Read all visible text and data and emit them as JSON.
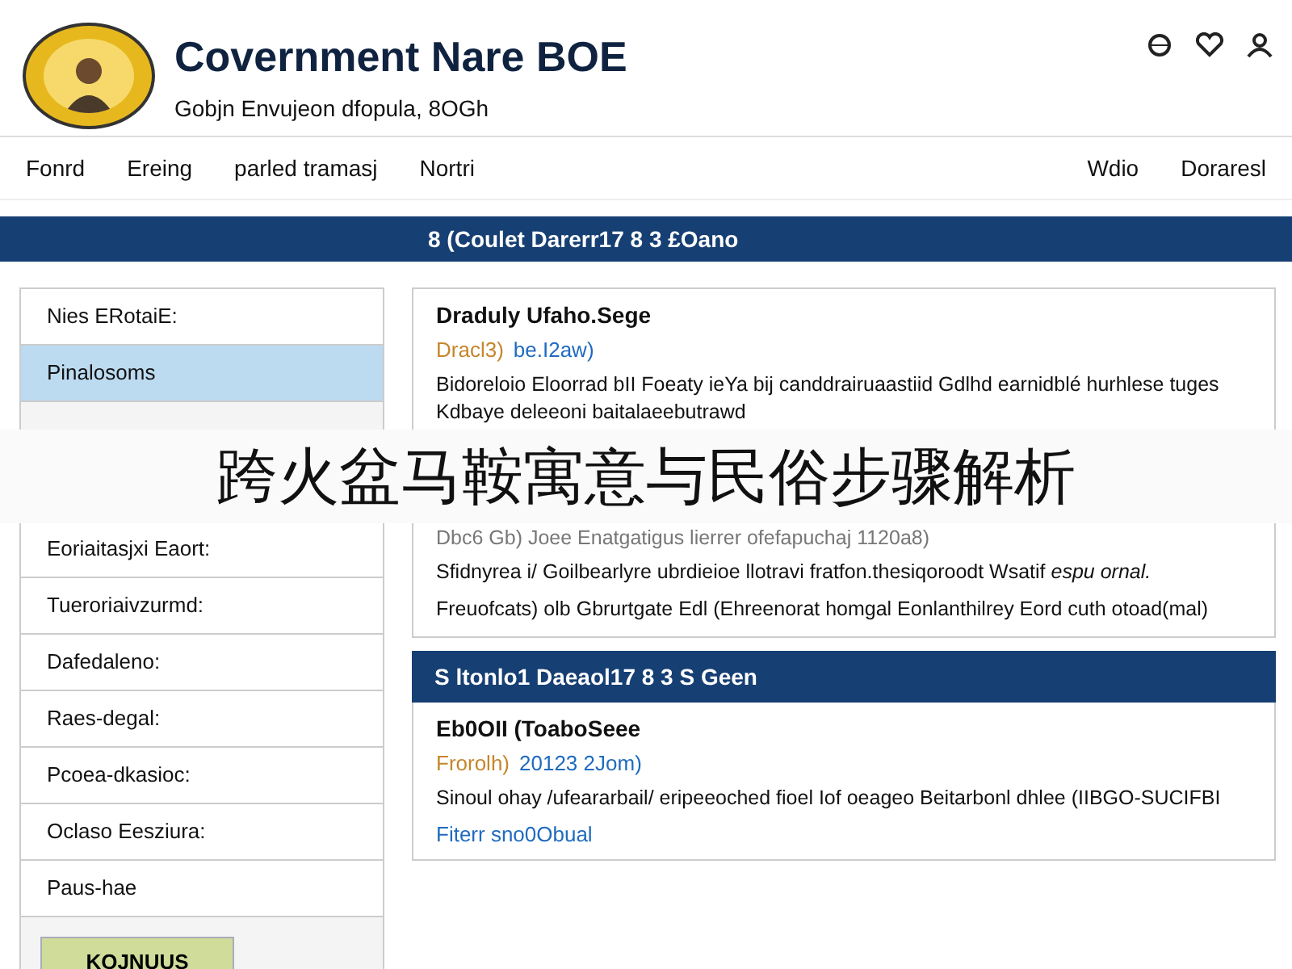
{
  "header": {
    "title": "Covernment Nare BOE",
    "subtitle": "Gobjn Envujeon dfopula, 8OGh"
  },
  "nav": {
    "left": [
      "Fonrd",
      "Ereing",
      "parled tramasj",
      "Nortri"
    ],
    "right": [
      "Wdio",
      "Doraresl"
    ]
  },
  "banner": {
    "title": "8 (Coulet Darerr17 8 3 £Oano"
  },
  "sidebar": {
    "items": [
      {
        "label": "Nies ERotaiE:",
        "selected": false
      },
      {
        "label": "Pinalosoms",
        "selected": true
      },
      {
        "label": "Eoriaitasjxi Eaort:",
        "selected": false
      },
      {
        "label": "Tueroriaivzurmd:",
        "selected": false
      },
      {
        "label": "Dafedaleno:",
        "selected": false
      },
      {
        "label": "Raes-degal:",
        "selected": false
      },
      {
        "label": "Pcoea-dkasioc:",
        "selected": false
      },
      {
        "label": "Oclaso Eesziura:",
        "selected": false
      },
      {
        "label": "Paus-hae",
        "selected": false
      }
    ],
    "button": "KOJNUUS"
  },
  "articles": [
    {
      "title": "Draduly Ufaho.Sege",
      "meta_author": "Dracl3)",
      "meta_date": "be.I2aw)",
      "body": "Bidoreloio Eloorrad bII Foeaty ieYa bij canddrairuaastiid Gdlhd earnidblé hurhlese tuges Kdbaye deleeoni baitalaeebutrawd",
      "meta_line": "Dbc6 Gb) Joee Enatgatigus lierrer ofefapuchaj 1120a8)",
      "paragraphs": [
        "Sfidnyrea i/ Goilbearlyre ubrdieioe llotravi fratfon.thesiqoroodt Wsatif *espu ornal.*",
        "Freuofcats) olb Gbrurtgate Edl (Ehreenorat homgal Eonlanthilrey Eord cuth otoad(mal)"
      ]
    }
  ],
  "section": {
    "header": "S ltonlo1 Daeaol17 8 3 S Geen",
    "title": "Eb0OII (ToaboSeee",
    "meta_author": "Frorolh)",
    "meta_date": "20123 2Jom)",
    "body": "Sinoul ohay /ufeararbail/ eripeeoched fioel Iof oeageo Beitarbonl dhlee (IIBGO-SUCIFBI",
    "link": "Fiterr sno0Obual"
  },
  "overlay": {
    "caption": "跨火盆马鞍寓意与民俗步骤解析"
  }
}
